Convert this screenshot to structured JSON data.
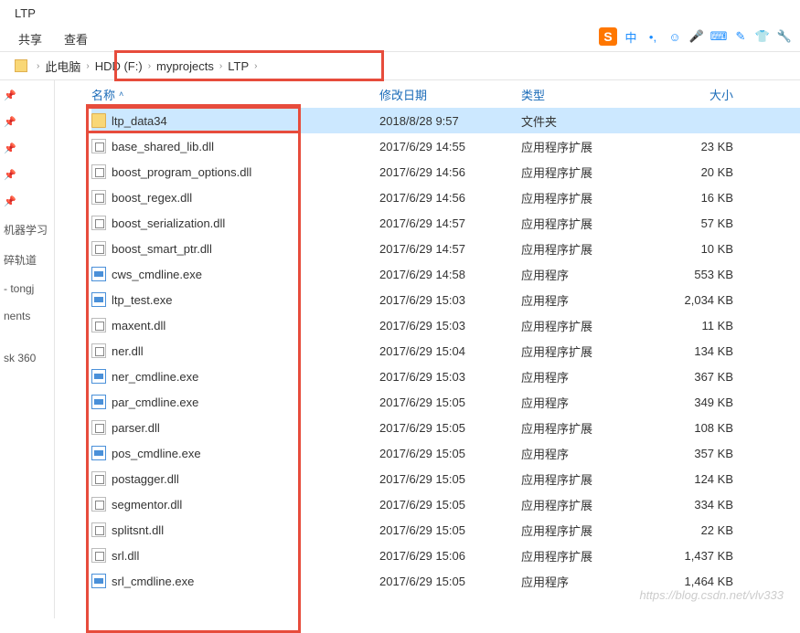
{
  "window": {
    "title": "LTP"
  },
  "menu": {
    "share": "共享",
    "view": "查看"
  },
  "breadcrumb": {
    "thispc": "此电脑",
    "items": [
      "HDD (F:)",
      "myprojects",
      "LTP"
    ]
  },
  "columns": {
    "name": "名称",
    "date": "修改日期",
    "type": "类型",
    "size": "大小"
  },
  "quickaccess": {
    "items": [
      "",
      "",
      "",
      "",
      "",
      "机器学习",
      "碎轨道",
      "- tongj",
      "nents",
      "",
      "sk 360"
    ]
  },
  "files": [
    {
      "name": "ltp_data34",
      "date": "2018/8/28 9:57",
      "type": "文件夹",
      "size": "",
      "icon": "folder",
      "selected": true
    },
    {
      "name": "base_shared_lib.dll",
      "date": "2017/6/29 14:55",
      "type": "应用程序扩展",
      "size": "23 KB",
      "icon": "dll"
    },
    {
      "name": "boost_program_options.dll",
      "date": "2017/6/29 14:56",
      "type": "应用程序扩展",
      "size": "20 KB",
      "icon": "dll"
    },
    {
      "name": "boost_regex.dll",
      "date": "2017/6/29 14:56",
      "type": "应用程序扩展",
      "size": "16 KB",
      "icon": "dll"
    },
    {
      "name": "boost_serialization.dll",
      "date": "2017/6/29 14:57",
      "type": "应用程序扩展",
      "size": "57 KB",
      "icon": "dll"
    },
    {
      "name": "boost_smart_ptr.dll",
      "date": "2017/6/29 14:57",
      "type": "应用程序扩展",
      "size": "10 KB",
      "icon": "dll"
    },
    {
      "name": "cws_cmdline.exe",
      "date": "2017/6/29 14:58",
      "type": "应用程序",
      "size": "553 KB",
      "icon": "exe"
    },
    {
      "name": "ltp_test.exe",
      "date": "2017/6/29 15:03",
      "type": "应用程序",
      "size": "2,034 KB",
      "icon": "exe"
    },
    {
      "name": "maxent.dll",
      "date": "2017/6/29 15:03",
      "type": "应用程序扩展",
      "size": "11 KB",
      "icon": "dll"
    },
    {
      "name": "ner.dll",
      "date": "2017/6/29 15:04",
      "type": "应用程序扩展",
      "size": "134 KB",
      "icon": "dll"
    },
    {
      "name": "ner_cmdline.exe",
      "date": "2017/6/29 15:03",
      "type": "应用程序",
      "size": "367 KB",
      "icon": "exe"
    },
    {
      "name": "par_cmdline.exe",
      "date": "2017/6/29 15:05",
      "type": "应用程序",
      "size": "349 KB",
      "icon": "exe"
    },
    {
      "name": "parser.dll",
      "date": "2017/6/29 15:05",
      "type": "应用程序扩展",
      "size": "108 KB",
      "icon": "dll"
    },
    {
      "name": "pos_cmdline.exe",
      "date": "2017/6/29 15:05",
      "type": "应用程序",
      "size": "357 KB",
      "icon": "exe"
    },
    {
      "name": "postagger.dll",
      "date": "2017/6/29 15:05",
      "type": "应用程序扩展",
      "size": "124 KB",
      "icon": "dll"
    },
    {
      "name": "segmentor.dll",
      "date": "2017/6/29 15:05",
      "type": "应用程序扩展",
      "size": "334 KB",
      "icon": "dll"
    },
    {
      "name": "splitsnt.dll",
      "date": "2017/6/29 15:05",
      "type": "应用程序扩展",
      "size": "22 KB",
      "icon": "dll"
    },
    {
      "name": "srl.dll",
      "date": "2017/6/29 15:06",
      "type": "应用程序扩展",
      "size": "1,437 KB",
      "icon": "dll"
    },
    {
      "name": "srl_cmdline.exe",
      "date": "2017/6/29 15:05",
      "type": "应用程序",
      "size": "1,464 KB",
      "icon": "exe"
    }
  ],
  "ime": {
    "logo": "S",
    "lang": "中"
  },
  "watermark": "https://blog.csdn.net/vlv333"
}
